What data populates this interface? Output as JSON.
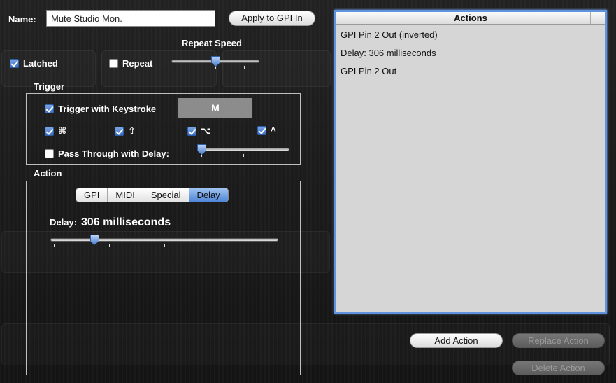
{
  "name": {
    "label": "Name:",
    "value": "Mute Studio Mon."
  },
  "apply_button": "Apply to GPI In",
  "repeat_speed": {
    "label": "Repeat Speed",
    "value_fraction": 0.5
  },
  "latched": {
    "label": "Latched",
    "checked": true
  },
  "repeat": {
    "label": "Repeat",
    "checked": false
  },
  "trigger": {
    "title": "Trigger",
    "keystroke": {
      "label": "Trigger with Keystroke",
      "checked": true,
      "key": "M"
    },
    "modifiers": [
      {
        "symbol": "⌘",
        "name": "command",
        "checked": true
      },
      {
        "symbol": "⇧",
        "name": "shift",
        "checked": true
      },
      {
        "symbol": "⌥",
        "name": "option",
        "checked": true
      },
      {
        "symbol": "^",
        "name": "control",
        "checked": true
      }
    ],
    "pass_through": {
      "label": "Pass Through with Delay:",
      "checked": false,
      "value_fraction": 0.0
    }
  },
  "action": {
    "title": "Action",
    "tabs": [
      "GPI",
      "MIDI",
      "Special",
      "Delay"
    ],
    "active_tab": "Delay",
    "delay_label": "Delay:",
    "delay_value": "306 milliseconds",
    "delay_fraction": 0.18
  },
  "actions_list": {
    "header": "Actions",
    "items": [
      "GPI Pin 2 Out (inverted)",
      "Delay: 306 milliseconds",
      "GPI Pin 2 Out"
    ]
  },
  "buttons": {
    "add": "Add Action",
    "replace": "Replace Action",
    "delete": "Delete Action"
  }
}
